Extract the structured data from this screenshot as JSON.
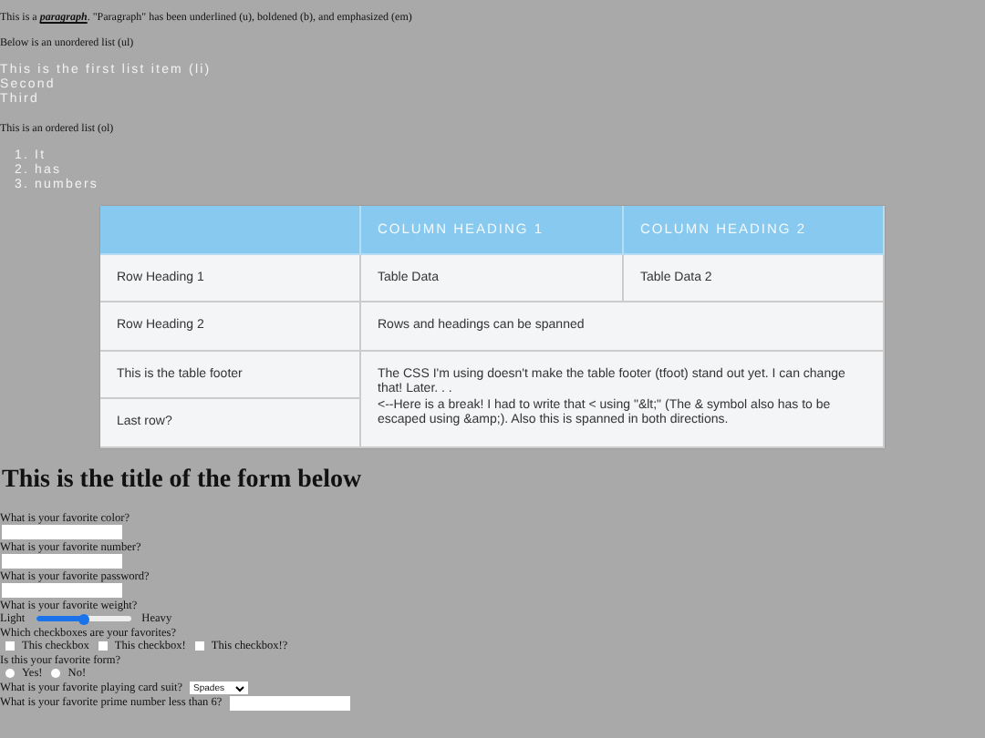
{
  "intro": {
    "paragraph": "This is a **paragraph**. \"Paragraph\" has been underlined (u), boldened (b), and emphasized (em)",
    "ul_caption": "Below is an unordered list (ul)",
    "ul_items": [
      "This is the first list item (li)",
      "Second",
      "Third"
    ],
    "ol_caption": "This is an ordered list (ol)",
    "ol_items": [
      {
        "marker": "1.",
        "text": "It"
      },
      {
        "marker": "2.",
        "text": "has"
      },
      {
        "marker": "3.",
        "text": "numbers"
      }
    ]
  },
  "table": {
    "columns": [
      "COLUMN HEADING 1",
      "COLUMN HEADING 2"
    ],
    "rows": [
      {
        "heading": "Row Heading 1",
        "cells": [
          {
            "lines": [
              "Table Data"
            ]
          },
          {
            "lines": [
              "Table Data 2"
            ]
          }
        ]
      },
      {
        "heading": "Row Heading 2",
        "cells": [
          {
            "lines": [
              "Rows and headings can be spanned"
            ],
            "colspan": 2
          }
        ]
      },
      {
        "heading": "This is the table footer",
        "cells": [
          {
            "lines": [
              "The CSS I'm using doesn't make the table footer (tfoot) stand out yet. I can change that! Later. . .",
              "<--Here is a break! I had to write that < using \"&lt;\" (The & symbol also has to be escaped using &amp;). Also this is spanned in both directions."
            ],
            "colspan": 2,
            "rowspan": 2
          }
        ]
      },
      {
        "heading": "Last row?",
        "cells": []
      }
    ]
  },
  "form": {
    "title": "This is the title of the form below",
    "items": [
      {
        "kind": "field",
        "label": "What is your favorite color?"
      },
      {
        "kind": "field",
        "label": "What is your favorite number?"
      },
      {
        "kind": "field",
        "label": "What is your favorite password?"
      },
      {
        "kind": "slider",
        "label": "What is your favorite weight?",
        "min_label": "Light",
        "max_label": "Heavy",
        "level": 0.5
      },
      {
        "kind": "checkboxes",
        "label": "Which checkboxes are your favorites?",
        "options": [
          {
            "label": "This checkbox",
            "checked": false
          },
          {
            "label": "This checkbox!",
            "checked": false
          },
          {
            "label": "This checkbox!?",
            "checked": false
          }
        ]
      },
      {
        "kind": "radios",
        "label": "Is this your favorite form?",
        "options": [
          {
            "label": "Yes!",
            "selected": false
          },
          {
            "label": "No!",
            "selected": false
          }
        ]
      },
      {
        "kind": "select",
        "label": "What is your favorite playing card suit?",
        "value": "Spades"
      },
      {
        "kind": "inline_field",
        "label": "What is your favorite prime number less than 6?"
      }
    ]
  }
}
